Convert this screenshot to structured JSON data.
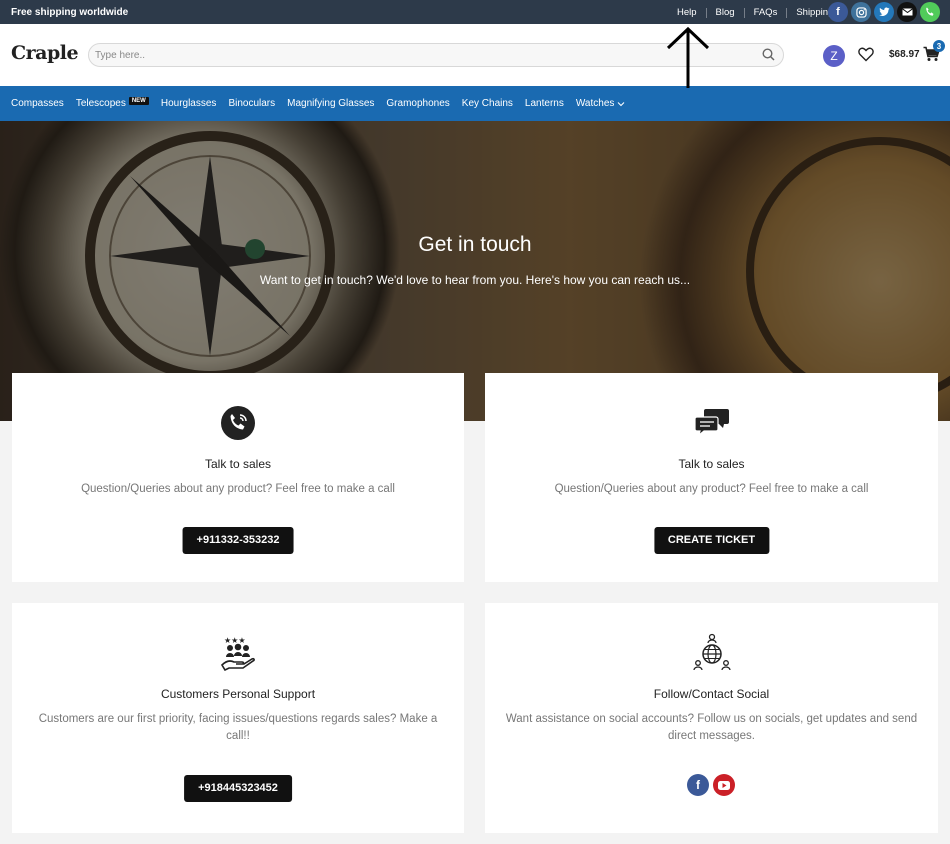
{
  "topbar": {
    "shipping_text": "Free shipping worldwide",
    "links": [
      "Help",
      "Blog",
      "FAQs",
      "Shipping"
    ],
    "social_icons": [
      {
        "name": "facebook-icon",
        "color": "#3b5998"
      },
      {
        "name": "instagram-icon",
        "color": "#3f729b"
      },
      {
        "name": "twitter-icon",
        "color": "#2478ba"
      },
      {
        "name": "email-icon",
        "color": "#111111"
      },
      {
        "name": "phone-icon",
        "color": "#51cb5a"
      }
    ]
  },
  "header": {
    "logo": "Craple",
    "search_placeholder": "Type here..",
    "avatar_letter": "Z",
    "cart_total": "$68.97",
    "cart_count": "3"
  },
  "nav": {
    "items": [
      {
        "label": "Compasses"
      },
      {
        "label": "Telescopes",
        "badge": "NEW"
      },
      {
        "label": "Hourglasses"
      },
      {
        "label": "Binoculars"
      },
      {
        "label": "Magnifying Glasses"
      },
      {
        "label": "Gramophones"
      },
      {
        "label": "Key Chains"
      },
      {
        "label": "Lanterns"
      },
      {
        "label": "Watches"
      }
    ]
  },
  "hero": {
    "title": "Get in touch",
    "subtitle": "Want to get in touch? We'd love to hear from you. Here's how you can reach us..."
  },
  "cards": [
    {
      "title": "Talk to sales",
      "description": "Question/Queries about any product? Feel free to make a call",
      "button": "+911332-353232",
      "icon": "phone-call-icon"
    },
    {
      "title": "Talk to sales",
      "description": "Question/Queries about any product? Feel free to make a call",
      "button": "CREATE TICKET",
      "icon": "chat-bubbles-icon"
    },
    {
      "title": "Customers Personal Support",
      "description": "Customers are our first priority, facing issues/questions regards sales? Make a call!!",
      "button": "+918445323452",
      "icon": "customer-support-icon"
    },
    {
      "title": "Follow/Contact Social",
      "description": "Want assistance on social accounts? Follow us on socials, get updates and send direct messages.",
      "icon": "social-network-icon",
      "socials": [
        {
          "name": "facebook-icon",
          "color": "#3b5998"
        },
        {
          "name": "youtube-icon",
          "color": "#cb2027"
        }
      ]
    }
  ],
  "colors": {
    "topbar": "#2d3a4a",
    "nav": "#1a6ab1",
    "button": "#111111"
  }
}
